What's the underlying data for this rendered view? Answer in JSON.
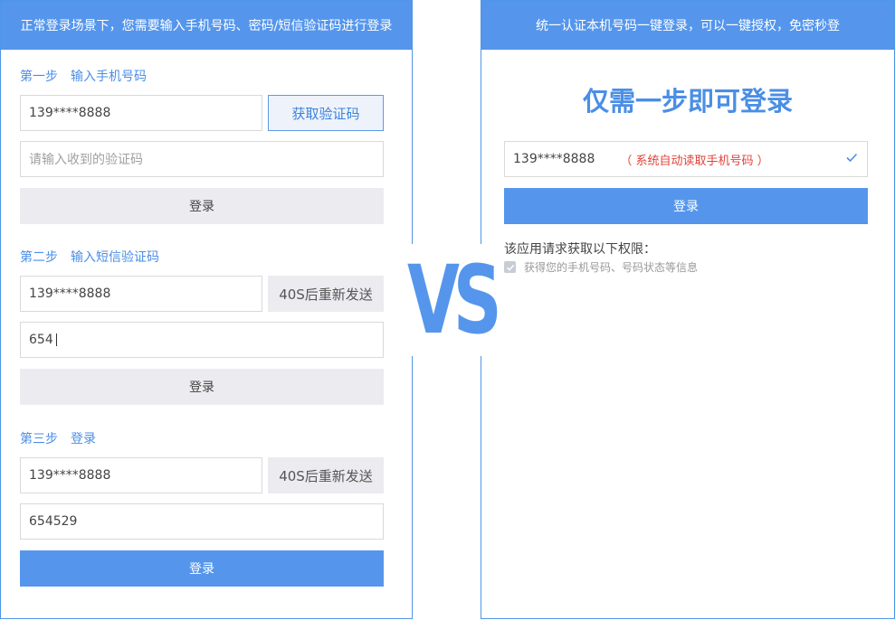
{
  "left": {
    "header": "正常登录场景下，您需要输入手机号码、密码/短信验证码进行登录",
    "step1": {
      "title": "第一步　输入手机号码",
      "phone_value": "139****8888",
      "get_code_button": "获取验证码",
      "code_placeholder": "请输入收到的验证码",
      "login_button": "登录"
    },
    "step2": {
      "title": "第二步　输入短信验证码",
      "phone_value": "139****8888",
      "resend_button": "40S后重新发送",
      "code_value": "654",
      "login_button": "登录"
    },
    "step3": {
      "title": "第三步　登录",
      "phone_value": "139****8888",
      "resend_button": "40S后重新发送",
      "code_value": "654529",
      "login_button": "登录"
    }
  },
  "vs": {
    "label": "VS"
  },
  "right": {
    "header": "统一认证本机号码一键登录，可以一键授权，免密秒登",
    "title": "仅需一步即可登录",
    "phone_value": "139****8888",
    "auto_hint": "（ 系统自动读取手机号码 ）",
    "login_button": "登录",
    "permission_title": "该应用请求获取以下权限：",
    "permission_item": "获得您的手机号码、号码状态等信息",
    "permission_checked": true
  },
  "colors": {
    "accent": "#5596ec",
    "border": "#4e95e8",
    "button_gray": "#ececf0",
    "hint_red": "#e0433a"
  },
  "icons": [
    "check-icon",
    "checkbox-checked-icon",
    "text-cursor"
  ]
}
